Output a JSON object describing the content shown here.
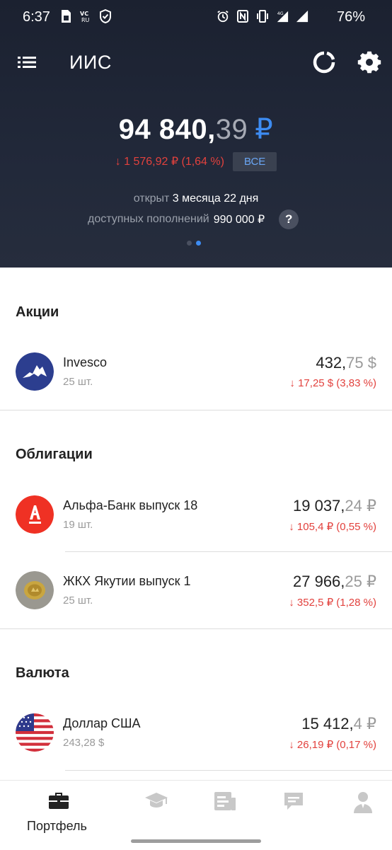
{
  "status_bar": {
    "time": "6:37",
    "left_icons": [
      "sim-card-icon",
      "vc-ru-icon",
      "shield-icon"
    ],
    "right_icons": [
      "alarm-icon",
      "nfc-icon",
      "vibrate-icon",
      "signal-4g-icon",
      "signal-icon"
    ],
    "battery": "76%"
  },
  "header": {
    "title": "ИИС",
    "balance_int": "94 840,",
    "balance_frac": "39",
    "balance_currency": "₽",
    "change": "↓ 1 576,92 ₽ (1,64 %)",
    "period_button": "ВСЕ",
    "opened_label": "открыт",
    "opened_value": "3 месяца 22 дня",
    "topups_label": "доступных пополнений",
    "topups_value": "990 000 ₽",
    "help_label": "?",
    "page_dots": {
      "total": 2,
      "active": 2
    }
  },
  "sections": [
    {
      "title": "Акции",
      "items": [
        {
          "name": "Invesco",
          "qty": "25 шт.",
          "price_int": "432,",
          "price_frac": "75 $",
          "change": "↓ 17,25 $ (3,83 %)",
          "logo": "invesco-logo"
        }
      ]
    },
    {
      "title": "Облигации",
      "items": [
        {
          "name": "Альфа-Банк выпуск 18",
          "qty": "19 шт.",
          "price_int": "19 037,",
          "price_frac": "24 ₽",
          "change": "↓ 105,4 ₽ (0,55 %)",
          "logo": "alfa-bank-logo"
        },
        {
          "name": "ЖКХ Якутии выпуск 1",
          "qty": "25 шт.",
          "price_int": "27 966,",
          "price_frac": "25 ₽",
          "change": "↓ 352,5 ₽ (1,28 %)",
          "logo": "yakutia-coin-logo"
        }
      ]
    },
    {
      "title": "Валюта",
      "items": [
        {
          "name": "Доллар США",
          "qty": "243,28 $",
          "price_int": "15 412,",
          "price_frac": "4 ₽",
          "change": "↓ 26,19 ₽ (0,17 %)",
          "logo": "usa-flag-logo"
        }
      ]
    }
  ],
  "bottom_nav": [
    {
      "label": "Портфель",
      "icon": "briefcase-icon",
      "active": true
    },
    {
      "label": "",
      "icon": "graduation-cap-icon",
      "active": false
    },
    {
      "label": "",
      "icon": "news-icon",
      "active": false
    },
    {
      "label": "",
      "icon": "chat-icon",
      "active": false
    },
    {
      "label": "",
      "icon": "profile-icon",
      "active": false
    }
  ],
  "colors": {
    "header_bg": "#1e2433",
    "accent_blue": "#3d8cf2",
    "negative_red": "#e2413d",
    "muted_grey": "#9a9a9a"
  }
}
